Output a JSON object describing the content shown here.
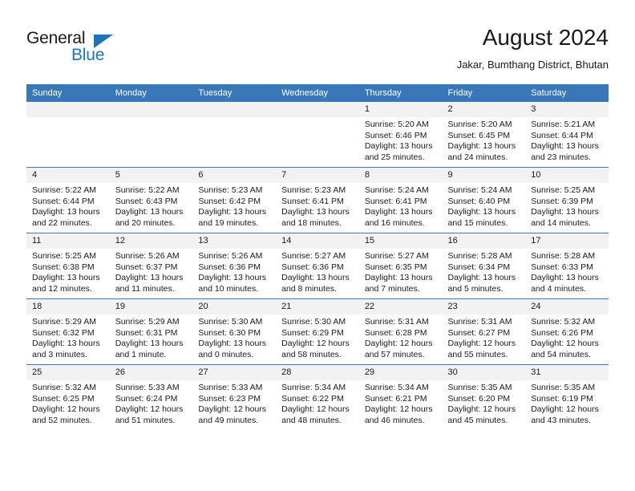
{
  "brand": {
    "name_part1": "General",
    "name_part2": "Blue",
    "accent_color": "#1b75bc"
  },
  "header": {
    "title": "August 2024",
    "subtitle": "Jakar, Bumthang District, Bhutan"
  },
  "calendar": {
    "header_background": "#3878b8",
    "daynum_background": "#f2f2f2",
    "weekday_headers": [
      "Sunday",
      "Monday",
      "Tuesday",
      "Wednesday",
      "Thursday",
      "Friday",
      "Saturday"
    ],
    "weeks": [
      [
        {
          "day": "",
          "blank": true
        },
        {
          "day": "",
          "blank": true
        },
        {
          "day": "",
          "blank": true
        },
        {
          "day": "",
          "blank": true
        },
        {
          "day": "1",
          "sunrise": "Sunrise: 5:20 AM",
          "sunset": "Sunset: 6:46 PM",
          "daylight": "Daylight: 13 hours and 25 minutes."
        },
        {
          "day": "2",
          "sunrise": "Sunrise: 5:20 AM",
          "sunset": "Sunset: 6:45 PM",
          "daylight": "Daylight: 13 hours and 24 minutes."
        },
        {
          "day": "3",
          "sunrise": "Sunrise: 5:21 AM",
          "sunset": "Sunset: 6:44 PM",
          "daylight": "Daylight: 13 hours and 23 minutes."
        }
      ],
      [
        {
          "day": "4",
          "sunrise": "Sunrise: 5:22 AM",
          "sunset": "Sunset: 6:44 PM",
          "daylight": "Daylight: 13 hours and 22 minutes."
        },
        {
          "day": "5",
          "sunrise": "Sunrise: 5:22 AM",
          "sunset": "Sunset: 6:43 PM",
          "daylight": "Daylight: 13 hours and 20 minutes."
        },
        {
          "day": "6",
          "sunrise": "Sunrise: 5:23 AM",
          "sunset": "Sunset: 6:42 PM",
          "daylight": "Daylight: 13 hours and 19 minutes."
        },
        {
          "day": "7",
          "sunrise": "Sunrise: 5:23 AM",
          "sunset": "Sunset: 6:41 PM",
          "daylight": "Daylight: 13 hours and 18 minutes."
        },
        {
          "day": "8",
          "sunrise": "Sunrise: 5:24 AM",
          "sunset": "Sunset: 6:41 PM",
          "daylight": "Daylight: 13 hours and 16 minutes."
        },
        {
          "day": "9",
          "sunrise": "Sunrise: 5:24 AM",
          "sunset": "Sunset: 6:40 PM",
          "daylight": "Daylight: 13 hours and 15 minutes."
        },
        {
          "day": "10",
          "sunrise": "Sunrise: 5:25 AM",
          "sunset": "Sunset: 6:39 PM",
          "daylight": "Daylight: 13 hours and 14 minutes."
        }
      ],
      [
        {
          "day": "11",
          "sunrise": "Sunrise: 5:25 AM",
          "sunset": "Sunset: 6:38 PM",
          "daylight": "Daylight: 13 hours and 12 minutes."
        },
        {
          "day": "12",
          "sunrise": "Sunrise: 5:26 AM",
          "sunset": "Sunset: 6:37 PM",
          "daylight": "Daylight: 13 hours and 11 minutes."
        },
        {
          "day": "13",
          "sunrise": "Sunrise: 5:26 AM",
          "sunset": "Sunset: 6:36 PM",
          "daylight": "Daylight: 13 hours and 10 minutes."
        },
        {
          "day": "14",
          "sunrise": "Sunrise: 5:27 AM",
          "sunset": "Sunset: 6:36 PM",
          "daylight": "Daylight: 13 hours and 8 minutes."
        },
        {
          "day": "15",
          "sunrise": "Sunrise: 5:27 AM",
          "sunset": "Sunset: 6:35 PM",
          "daylight": "Daylight: 13 hours and 7 minutes."
        },
        {
          "day": "16",
          "sunrise": "Sunrise: 5:28 AM",
          "sunset": "Sunset: 6:34 PM",
          "daylight": "Daylight: 13 hours and 5 minutes."
        },
        {
          "day": "17",
          "sunrise": "Sunrise: 5:28 AM",
          "sunset": "Sunset: 6:33 PM",
          "daylight": "Daylight: 13 hours and 4 minutes."
        }
      ],
      [
        {
          "day": "18",
          "sunrise": "Sunrise: 5:29 AM",
          "sunset": "Sunset: 6:32 PM",
          "daylight": "Daylight: 13 hours and 3 minutes."
        },
        {
          "day": "19",
          "sunrise": "Sunrise: 5:29 AM",
          "sunset": "Sunset: 6:31 PM",
          "daylight": "Daylight: 13 hours and 1 minute."
        },
        {
          "day": "20",
          "sunrise": "Sunrise: 5:30 AM",
          "sunset": "Sunset: 6:30 PM",
          "daylight": "Daylight: 13 hours and 0 minutes."
        },
        {
          "day": "21",
          "sunrise": "Sunrise: 5:30 AM",
          "sunset": "Sunset: 6:29 PM",
          "daylight": "Daylight: 12 hours and 58 minutes."
        },
        {
          "day": "22",
          "sunrise": "Sunrise: 5:31 AM",
          "sunset": "Sunset: 6:28 PM",
          "daylight": "Daylight: 12 hours and 57 minutes."
        },
        {
          "day": "23",
          "sunrise": "Sunrise: 5:31 AM",
          "sunset": "Sunset: 6:27 PM",
          "daylight": "Daylight: 12 hours and 55 minutes."
        },
        {
          "day": "24",
          "sunrise": "Sunrise: 5:32 AM",
          "sunset": "Sunset: 6:26 PM",
          "daylight": "Daylight: 12 hours and 54 minutes."
        }
      ],
      [
        {
          "day": "25",
          "sunrise": "Sunrise: 5:32 AM",
          "sunset": "Sunset: 6:25 PM",
          "daylight": "Daylight: 12 hours and 52 minutes."
        },
        {
          "day": "26",
          "sunrise": "Sunrise: 5:33 AM",
          "sunset": "Sunset: 6:24 PM",
          "daylight": "Daylight: 12 hours and 51 minutes."
        },
        {
          "day": "27",
          "sunrise": "Sunrise: 5:33 AM",
          "sunset": "Sunset: 6:23 PM",
          "daylight": "Daylight: 12 hours and 49 minutes."
        },
        {
          "day": "28",
          "sunrise": "Sunrise: 5:34 AM",
          "sunset": "Sunset: 6:22 PM",
          "daylight": "Daylight: 12 hours and 48 minutes."
        },
        {
          "day": "29",
          "sunrise": "Sunrise: 5:34 AM",
          "sunset": "Sunset: 6:21 PM",
          "daylight": "Daylight: 12 hours and 46 minutes."
        },
        {
          "day": "30",
          "sunrise": "Sunrise: 5:35 AM",
          "sunset": "Sunset: 6:20 PM",
          "daylight": "Daylight: 12 hours and 45 minutes."
        },
        {
          "day": "31",
          "sunrise": "Sunrise: 5:35 AM",
          "sunset": "Sunset: 6:19 PM",
          "daylight": "Daylight: 12 hours and 43 minutes."
        }
      ]
    ]
  }
}
